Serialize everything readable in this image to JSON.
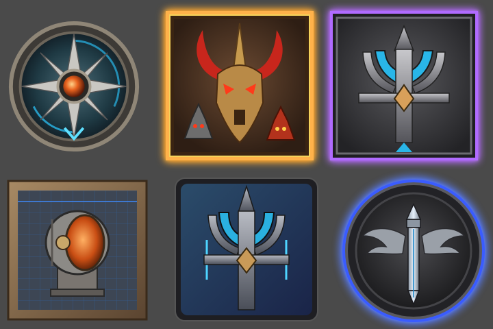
{
  "canvas": {
    "background": "#4a4a4a"
  },
  "icons": [
    {
      "id": "t1",
      "name": "round-shield-orb-icon",
      "frame": "circle",
      "accent": "#29b6e8",
      "gem": "#e8621e"
    },
    {
      "id": "t2",
      "name": "demon-skull-icon",
      "frame": "square",
      "glow": "#ff8a1c",
      "accent": "#c8261c"
    },
    {
      "id": "t3",
      "name": "trident-crest-icon",
      "frame": "square",
      "glow": "#9a3dff",
      "accent": "#29b6e8"
    },
    {
      "id": "t4",
      "name": "steel-barrel-icon",
      "frame": "square",
      "accent": "#e06a1e",
      "grid": "#2a72c8"
    },
    {
      "id": "t5",
      "name": "blue-trident-icon",
      "frame": "rounded-square",
      "accent": "#2ab0e0"
    },
    {
      "id": "t6",
      "name": "winged-sword-icon",
      "frame": "circle",
      "glow": "#2f56ff",
      "accent": "#d9ecff"
    }
  ]
}
